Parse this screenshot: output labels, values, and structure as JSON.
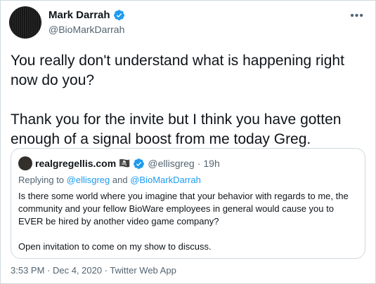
{
  "author": {
    "name": "Mark Darrah",
    "handle": "@BioMarkDarrah",
    "more_icon": "•••"
  },
  "tweet": {
    "text": "You really don't understand what is happening right now do you?\n\nThank you for the invite but I think you have gotten enough of a signal boost from me today Greg."
  },
  "quote": {
    "name": "realgregellis.com",
    "flag_icon": "🏴‍☠️",
    "handle": "@ellisgreg",
    "separator": "·",
    "time": "19h",
    "replying_prefix": "Replying to ",
    "reply_user_1": "@ellisgreg",
    "reply_and": " and ",
    "reply_user_2": "@BioMarkDarrah",
    "text": "Is there some world where you imagine that your behavior with regards to me, the community and your fellow BioWare employees in general would cause you to EVER be hired by another video game company?\n\nOpen invitation to come on my show to discuss."
  },
  "footer": {
    "text": "3:53 PM · Dec 4, 2020 · Twitter Web App"
  },
  "colors": {
    "verified": "#1d9bf0",
    "secondary_text": "#536471",
    "border": "#cfd9de"
  }
}
